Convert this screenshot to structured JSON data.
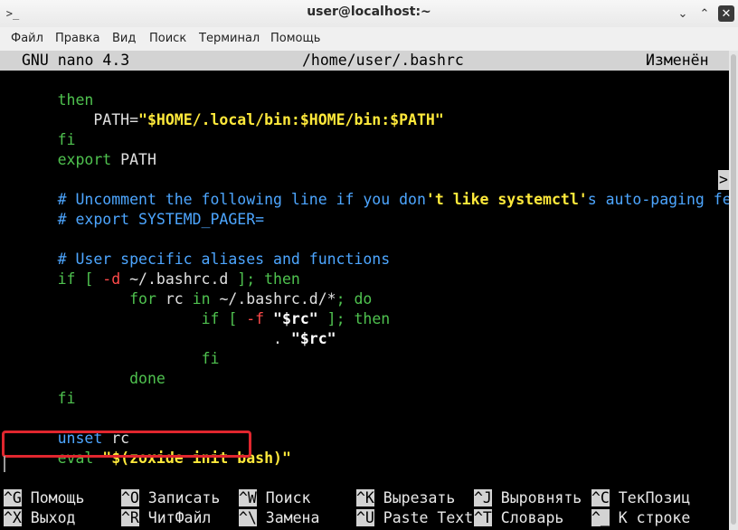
{
  "window": {
    "title": "user@localhost:~",
    "app_icon": "terminal-icon",
    "buttons": {
      "minimize": "⌄",
      "maximize": "⌃",
      "close": "✕"
    }
  },
  "menu": {
    "file": "Файл",
    "edit": "Правка",
    "view": "Вид",
    "search": "Поиск",
    "terminal": "Терминал",
    "help": "Помощь"
  },
  "nano": {
    "version": "GNU nano 4.3",
    "filename": "/home/user/.bashrc",
    "status": "Изменён",
    "overflow_indicator": ">"
  },
  "code": {
    "l1_then": "then",
    "l2_indent": "    ",
    "l2_path": "PATH=",
    "l2_value": "\"$HOME/.local/bin:$HOME/bin:$PATH\"",
    "l3_fi": "fi",
    "l4_export": "export",
    "l4_rest": " PATH",
    "l6_comment_a": "# Uncomment the following line if you don",
    "l6_str": "'t like systemctl'",
    "l6_comment_b": "s auto-paging featur",
    "l7_comment": "# export SYSTEMD_PAGER=",
    "l9_comment": "# User specific aliases and functions",
    "l10_if": "if [ ",
    "l10_flag": "-d",
    "l10_path": " ~/.bashrc.d ",
    "l10_then": "]; then",
    "l11_indent": "        ",
    "l11_for": "for",
    "l11_rc": " rc ",
    "l11_in": "in",
    "l11_path": " ~/.bashrc.d/*",
    "l11_do": "; do",
    "l12_indent": "                ",
    "l12_if": "if [ ",
    "l12_flag": "-f",
    "l12_space": " ",
    "l12_var": "\"$rc\"",
    "l12_then": " ]; then",
    "l13_indent": "                        ",
    "l13_dot": ". ",
    "l13_var": "\"$rc\"",
    "l14_indent": "                ",
    "l14_fi": "fi",
    "l15_indent": "        ",
    "l15_done": "done",
    "l16_fi": "fi",
    "l18_unset": "unset",
    "l18_rest": " rc",
    "l19_eval": "eval",
    "l19_space": " ",
    "l19_cmd": "\"$(zoxide init bash)\""
  },
  "shortcuts": [
    {
      "key": "^G",
      "label": " Помощь"
    },
    {
      "key": "^O",
      "label": " Записать"
    },
    {
      "key": "^W",
      "label": " Поиск"
    },
    {
      "key": "^K",
      "label": " Вырезать"
    },
    {
      "key": "^J",
      "label": " Выровнять"
    },
    {
      "key": "^C",
      "label": " ТекПозиц"
    },
    {
      "key": "^X",
      "label": " Выход"
    },
    {
      "key": "^R",
      "label": " ЧитФайл"
    },
    {
      "key": "^\\",
      "label": " Замена"
    },
    {
      "key": "^U",
      "label": " Paste Text"
    },
    {
      "key": "^T",
      "label": " Словарь"
    },
    {
      "key": "^_",
      "label": " К строке"
    }
  ],
  "colors": {
    "keyword": "#4fc24f",
    "comment": "#4da6ff",
    "string": "#ffe93b",
    "highlight_border": "#e0262e"
  }
}
